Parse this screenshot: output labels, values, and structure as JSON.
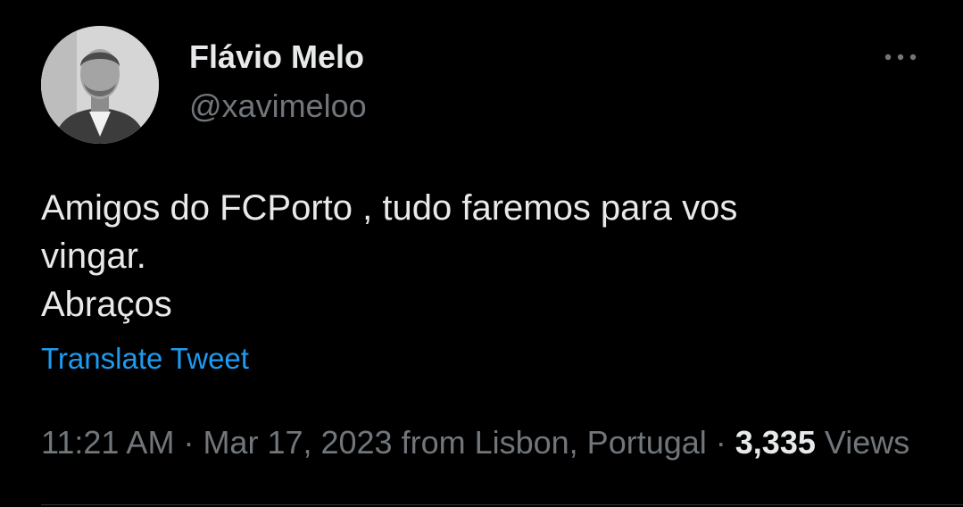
{
  "author": {
    "display_name": "Flávio Melo",
    "handle": "@xavimeloo",
    "avatar_icon": "profile-photo"
  },
  "tweet": {
    "lines": [
      "Amigos do FCPorto , tudo faremos para vos",
      "vingar.",
      "Abraços"
    ],
    "translate_label": "Translate Tweet"
  },
  "meta": {
    "time": "11:21 AM",
    "separator": " · ",
    "date": "Mar 17, 2023",
    "location": "from Lisbon, Portugal",
    "views_count": "3,335",
    "views_label": "Views"
  },
  "more_icon": "more-horizontal-icon",
  "colors": {
    "background": "#000000",
    "text": "#e7e9ea",
    "secondary": "#71767b",
    "link": "#1d9bf0"
  }
}
